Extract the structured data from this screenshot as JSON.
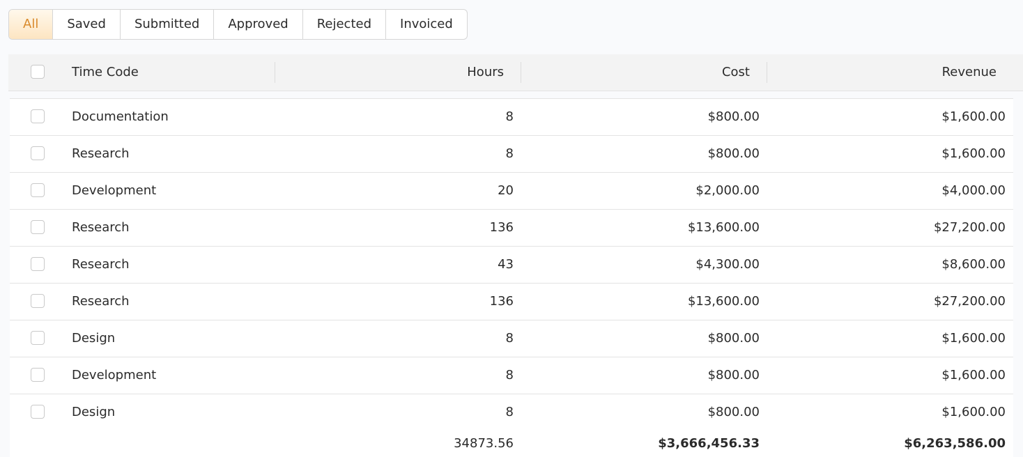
{
  "tabs": [
    {
      "label": "All",
      "active": true
    },
    {
      "label": "Saved",
      "active": false
    },
    {
      "label": "Submitted",
      "active": false
    },
    {
      "label": "Approved",
      "active": false
    },
    {
      "label": "Rejected",
      "active": false
    },
    {
      "label": "Invoiced",
      "active": false
    }
  ],
  "table": {
    "columns": {
      "time_code": "Time Code",
      "hours": "Hours",
      "cost": "Cost",
      "revenue": "Revenue"
    },
    "rows": [
      {
        "time_code": "Documentation",
        "hours": "8",
        "cost": "$800.00",
        "revenue": "$1,600.00"
      },
      {
        "time_code": "Research",
        "hours": "8",
        "cost": "$800.00",
        "revenue": "$1,600.00"
      },
      {
        "time_code": "Development",
        "hours": "20",
        "cost": "$2,000.00",
        "revenue": "$4,000.00"
      },
      {
        "time_code": "Research",
        "hours": "136",
        "cost": "$13,600.00",
        "revenue": "$27,200.00"
      },
      {
        "time_code": "Research",
        "hours": "43",
        "cost": "$4,300.00",
        "revenue": "$8,600.00"
      },
      {
        "time_code": "Research",
        "hours": "136",
        "cost": "$13,600.00",
        "revenue": "$27,200.00"
      },
      {
        "time_code": "Design",
        "hours": "8",
        "cost": "$800.00",
        "revenue": "$1,600.00"
      },
      {
        "time_code": "Development",
        "hours": "8",
        "cost": "$800.00",
        "revenue": "$1,600.00"
      },
      {
        "time_code": "Design",
        "hours": "8",
        "cost": "$800.00",
        "revenue": "$1,600.00"
      }
    ],
    "totals": {
      "hours": "34873.56",
      "cost": "$3,666,456.33",
      "revenue": "$6,263,586.00"
    }
  },
  "colors": {
    "accent": "#d98a2c",
    "accent_bg": "#fde5c2",
    "header_bg": "#f3f3f3",
    "border": "#e3e3e3"
  }
}
